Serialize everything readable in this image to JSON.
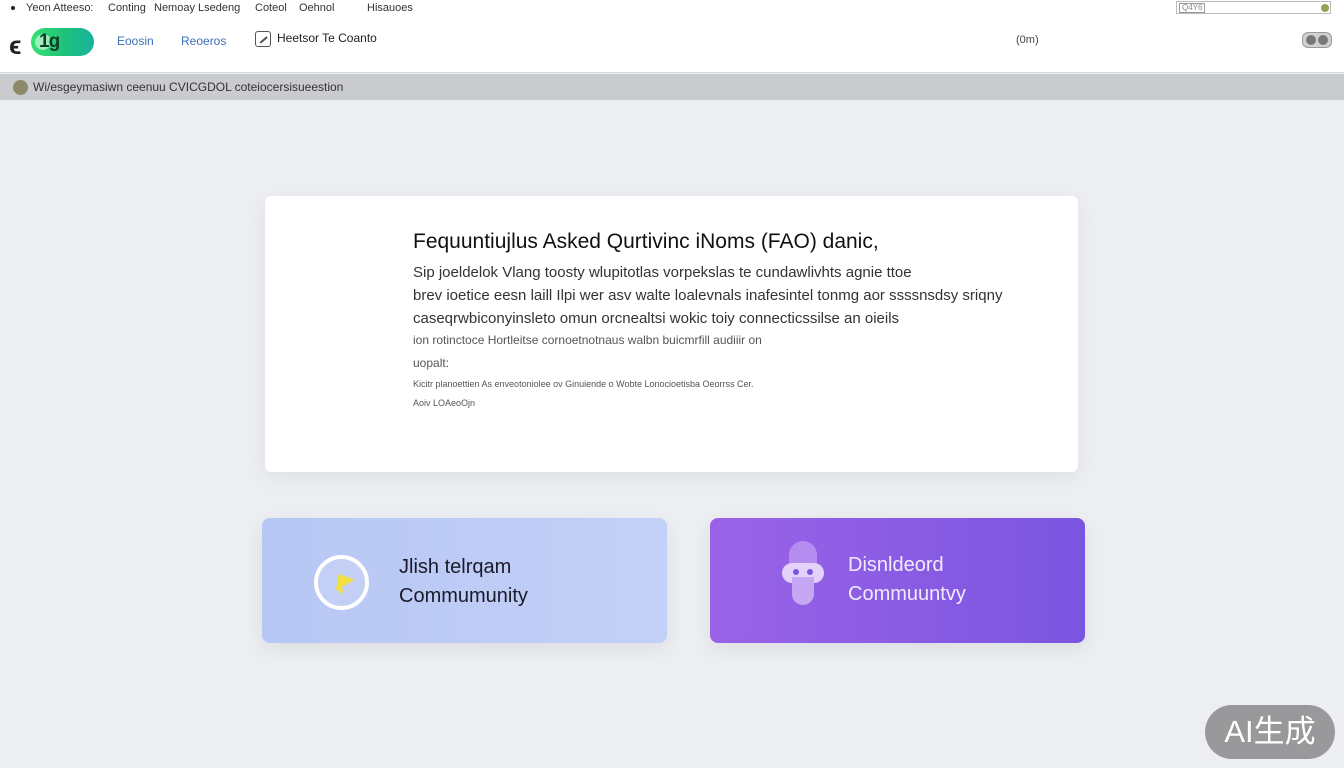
{
  "top_menu": {
    "items": [
      "Yeon Atteeso:",
      "Conting",
      "Nemoay Lsedeng",
      "Coteol",
      "Oehnol",
      "Hisauoes"
    ],
    "search_tag": "Q4Y6"
  },
  "header": {
    "logo_text": "1g",
    "nav": [
      "Eoosin",
      "Reoeros"
    ],
    "link_with_icon": "Heetsor Te Coanto",
    "right_link": "(0m)"
  },
  "breadcrumb": {
    "text": "Wi/esgeymasiwn ceenuu CVICGDOL coteiocersisueestion"
  },
  "faq": {
    "title": "Fequuntiujlus Asked Qurtivinc iNoms (FAO) danic,",
    "lines": [
      "Sip joeldelok Vlang toosty wlupitotlas vorpekslas te cundawlivhts agnie ttoe",
      "brev ioetice eesn laill Ilpi wer asv walte loalevnals inafesintel tonmg aor ssssnsdsy sriqny",
      "caseqrwbiconyinsleto omun orcnealtsi wokic toiy connecticssilse an oieils",
      "ion  rotinctoce Hortleitse  cornoetnotnaus  walbn buicmrfill audiiir on",
      "uopalt:",
      "Kicitr planoettien  As  enveotoniolee  ov Ginuiende  o Wobte  Lonocioetisba Oeorrss  Cer.",
      "Aoiv  LOAeoOjn"
    ]
  },
  "community": {
    "telegram": {
      "line1": "Jlish telrqam",
      "line2": "Commumunity"
    },
    "discord": {
      "line1": "Disnldeord",
      "line2": "Commuuntvy"
    }
  },
  "watermark": "AI生成",
  "colors": {
    "telegram_card": "#b9c8f5",
    "discord_card": "#8a5ce4",
    "logo_green": "#2bd07a",
    "nav_blue": "#3b6db8",
    "page_bg": "#eceef2"
  }
}
